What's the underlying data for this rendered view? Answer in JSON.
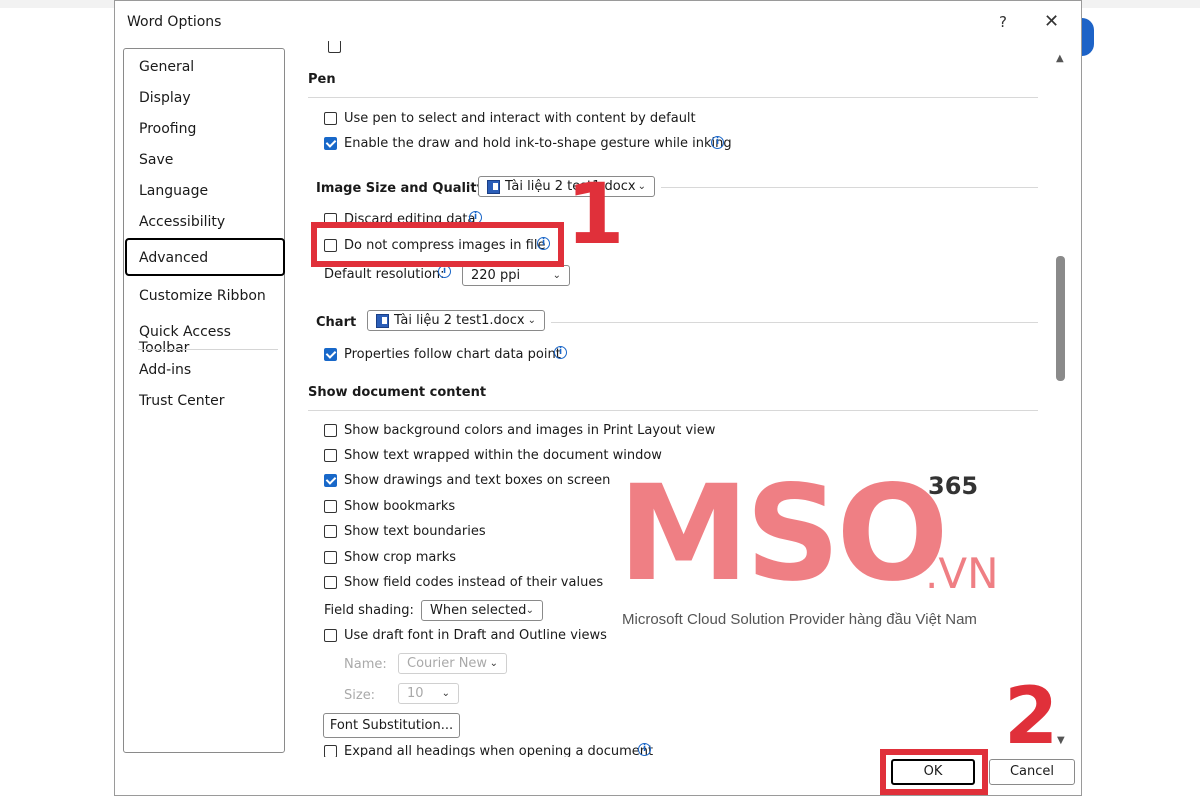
{
  "window": {
    "title": "Word Options",
    "help_label": "?",
    "close_label": "✕"
  },
  "sidebar": {
    "items": [
      {
        "label": "General"
      },
      {
        "label": "Display"
      },
      {
        "label": "Proofing"
      },
      {
        "label": "Save"
      },
      {
        "label": "Language"
      },
      {
        "label": "Accessibility"
      },
      {
        "label": "Advanced",
        "selected": true
      },
      {
        "label": "Customize Ribbon"
      },
      {
        "label": "Quick Access Toolbar"
      },
      {
        "label": "Add-ins"
      },
      {
        "label": "Trust Center"
      }
    ]
  },
  "pen": {
    "header": "Pen",
    "options": [
      {
        "label": "Use pen to select and interact with content by default",
        "checked": false
      },
      {
        "label": "Enable the draw and hold ink-to-shape gesture while inking",
        "checked": true
      }
    ]
  },
  "image_quality": {
    "header": "Image Size and Quality",
    "document": "Tài liệu 2 test1.docx",
    "options": [
      {
        "label": "Discard editing data",
        "checked": false
      },
      {
        "label": "Do not compress images in file",
        "checked": false
      }
    ],
    "resolution_label": "Default resolution:",
    "resolution_value": "220 ppi"
  },
  "chart": {
    "header": "Chart",
    "document": "Tài liệu 2 test1.docx",
    "options": [
      {
        "label": "Properties follow chart data point",
        "checked": true
      }
    ]
  },
  "show_content": {
    "header": "Show document content",
    "options": [
      {
        "label": "Show background colors and images in Print Layout view",
        "checked": false
      },
      {
        "label": "Show text wrapped within the document window",
        "checked": false
      },
      {
        "label": "Show drawings and text boxes on screen",
        "checked": true
      },
      {
        "label": "Show bookmarks",
        "checked": false
      },
      {
        "label": "Show text boundaries",
        "checked": false
      },
      {
        "label": "Show crop marks",
        "checked": false
      },
      {
        "label": "Show field codes instead of their values",
        "checked": false
      }
    ],
    "field_shading_label": "Field shading:",
    "field_shading_value": "When selected",
    "draft_font": {
      "label": "Use draft font in Draft and Outline views",
      "checked": false
    },
    "name_label": "Name:",
    "name_value": "Courier New",
    "size_label": "Size:",
    "size_value": "10",
    "font_sub_button": "Font Substitution...",
    "expand_headings": {
      "label": "Expand all headings when opening a document",
      "checked": false
    }
  },
  "footer": {
    "ok_label": "OK",
    "cancel_label": "Cancel"
  },
  "annotations": {
    "step1": "1",
    "step2": "2"
  },
  "watermark": {
    "brand": "MSO",
    "superscript": "365",
    "suffix": ".VN",
    "tagline": "Microsoft Cloud Solution Provider hàng đầu Việt Nam"
  },
  "colors": {
    "accent": "#1868c9",
    "annotation_red": "#e0303a",
    "watermark": "#ec696e"
  }
}
